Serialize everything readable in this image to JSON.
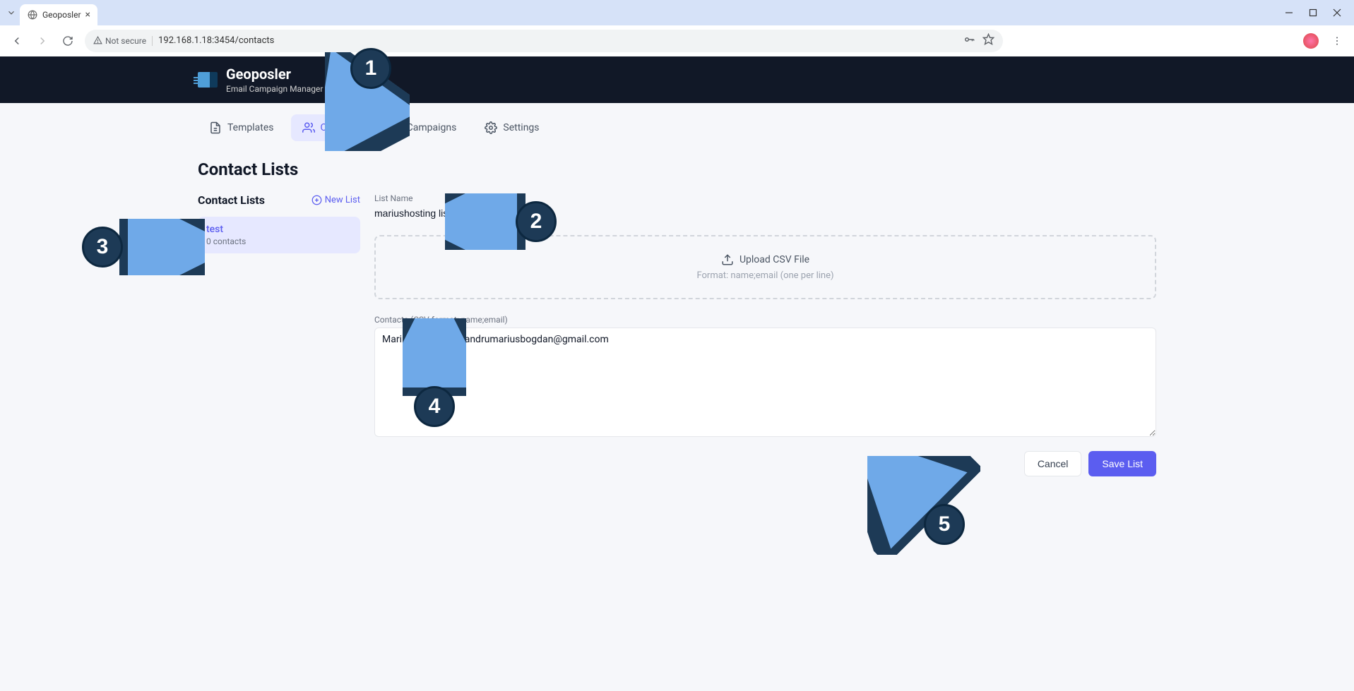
{
  "browser": {
    "tab_title": "Geoposler",
    "url": "192.168.1.18:3454/contacts",
    "security_label": "Not secure"
  },
  "app": {
    "title": "Geoposler",
    "subtitle": "Email Campaign Manager"
  },
  "nav": {
    "templates": "Templates",
    "contacts": "Contacts",
    "campaigns": "Campaigns",
    "settings": "Settings"
  },
  "page": {
    "title": "Contact Lists"
  },
  "sidebar": {
    "title": "Contact Lists",
    "new_list_label": "New List",
    "items": [
      {
        "name": "test",
        "count": "0 contacts"
      }
    ]
  },
  "form": {
    "list_name_label": "List Name",
    "list_name_value": "mariushosting list",
    "upload_label": "Upload CSV File",
    "upload_format": "Format: name;email (one per line)",
    "contacts_label": "Contacts (CSV format: name;email)",
    "contacts_value": "Marius Lixandru;lixandrumariusbogdan@gmail.com",
    "cancel_label": "Cancel",
    "save_label": "Save List"
  },
  "annotations": {
    "a1": "1",
    "a2": "2",
    "a3": "3",
    "a4": "4",
    "a5": "5"
  }
}
